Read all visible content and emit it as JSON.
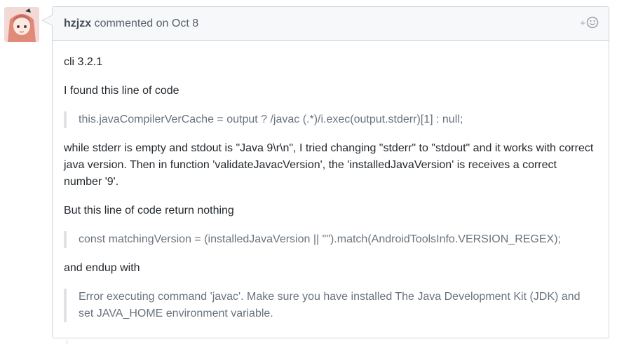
{
  "comment": {
    "author": "hzjzx",
    "action": "commented on",
    "date": "Oct 8",
    "reaction_plus": "+",
    "body": {
      "p1": "cli 3.2.1",
      "p2": "I found this line of code",
      "quote1": "this.javaCompilerVerCache = output ? /javac (.*)/i.exec(output.stderr)[1] : null;",
      "p3": "while stderr is empty and stdout is \"Java 9\\r\\n\", I tried changing \"stderr\" to \"stdout\" and it works with correct java version. Then in function 'validateJavacVersion', the 'installedJavaVersion' is receives a correct number '9'.",
      "p4": "But this line of code return nothing",
      "quote2": "const matchingVersion = (installedJavaVersion || \"\").match(AndroidToolsInfo.VERSION_REGEX);",
      "p5": "and endup with",
      "quote3": "Error executing command 'javac'. Make sure you have installed The Java Development Kit (JDK) and set JAVA_HOME environment variable."
    }
  },
  "icons": {
    "avatar": "anime-avatar",
    "reaction": "smiley-icon"
  },
  "colors": {
    "header_bg": "#f6f8fa",
    "border": "#d1d5da",
    "quote_text": "#6a737d"
  }
}
